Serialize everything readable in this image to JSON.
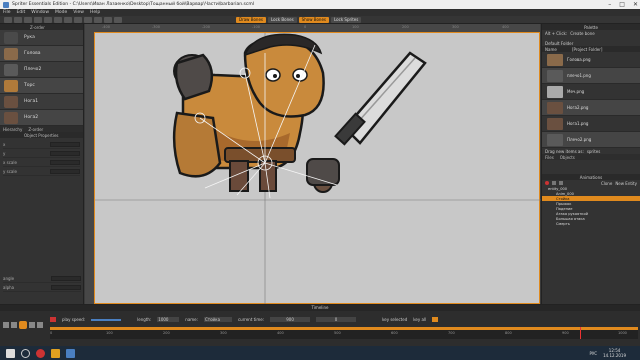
{
  "app": {
    "title": "Spriter Essentials Edition",
    "path": "C:\\Users\\Иван Лазаенко\\Desktop\\Тощанный бой\\Варвар\\Части\\barbarian.scml",
    "menu": [
      "File",
      "Edit",
      "Window",
      "Mode",
      "View",
      "Help"
    ]
  },
  "toolbar": {
    "buttons": [
      "Draw Bones",
      "Lock Bones",
      "Show Bones",
      "Lock Sprites"
    ]
  },
  "left_panel": {
    "header": "Z-order",
    "items": [
      "Рука",
      "Голова",
      "Плечо2",
      "Торс",
      "Нога1",
      "Нога2"
    ],
    "tabs": [
      "Hierarchy",
      "Z-order"
    ],
    "object_properties": {
      "header": "Object Properties",
      "rows": [
        "x",
        "y",
        "x scale",
        "y scale"
      ],
      "bottom_rows": [
        "angle",
        "alpha"
      ]
    }
  },
  "ruler": {
    "top_ticks": [
      "-400",
      "-300",
      "-200",
      "-100",
      "0",
      "100",
      "200",
      "300",
      "400"
    ]
  },
  "right_panel": {
    "palette_header": "Palette",
    "palette_controls": [
      "Alt + Click:",
      "Create bone"
    ],
    "default_folder": "Default Folder",
    "columns": [
      "Name",
      "[Project Folder]"
    ],
    "files": [
      "Голова.png",
      "плечо1.png",
      "Меч.png",
      "Нога2.png",
      "Нога1.png",
      "Плечо2.png"
    ],
    "drop_hint": "Drag new items as:",
    "drop_value": "sprites",
    "tabs": [
      "Files",
      "Objects"
    ],
    "animations_header": "Animations",
    "entity": "entity_000",
    "anim_buttons": [
      "Clone",
      "New Entity"
    ],
    "animations": [
      "Anim_000",
      "Стойка",
      "Прыжок",
      "Падение",
      "Атака рукояткой",
      "Большая атака",
      "Смерть"
    ],
    "bottom_tabs": [
      "History",
      "Animations"
    ]
  },
  "timeline": {
    "label": "Timeline",
    "play_speed_label": "play speed:",
    "length_label": "length:",
    "length_value": "1000",
    "name_label": "name:",
    "name_value": "Стойка",
    "current_time_label": "current time:",
    "current_time_value": "900",
    "snap_value": "0",
    "key_selected": "key selected",
    "key_all": "key all",
    "ticks": [
      "0",
      "100",
      "200",
      "300",
      "400",
      "500",
      "600",
      "700",
      "800",
      "900",
      "1000"
    ]
  },
  "taskbar": {
    "language": "РУС",
    "time": "12:54",
    "date": "14.12.2019"
  },
  "colors": {
    "accent": "#e08a1e",
    "canvas_bg": "#c8c8c8",
    "panel_bg": "#333333",
    "taskbar": "#1d2b3a"
  }
}
